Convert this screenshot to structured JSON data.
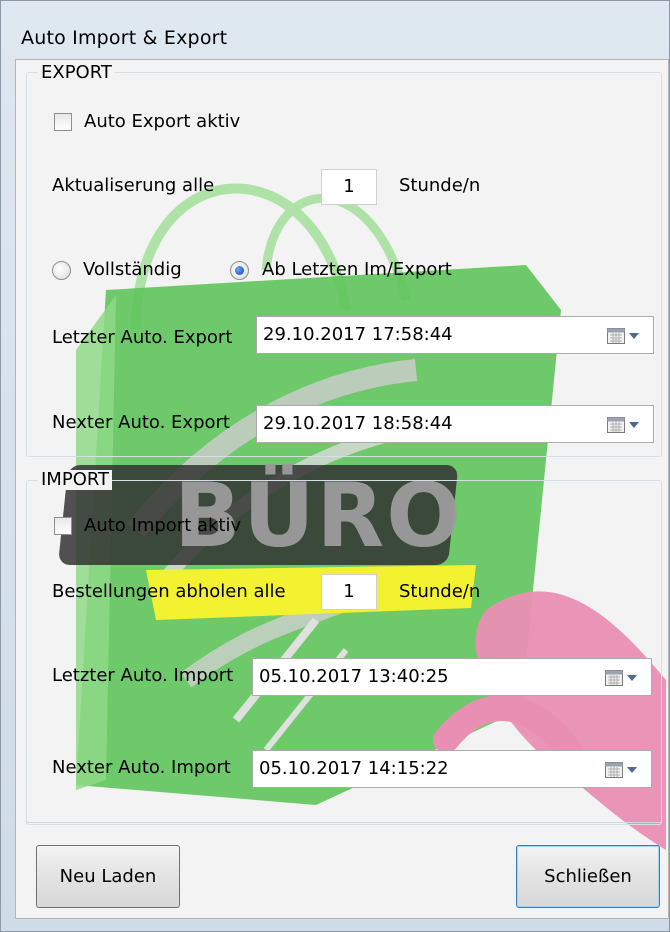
{
  "window": {
    "title": "Auto Import & Export"
  },
  "export": {
    "legend": "EXPORT",
    "auto_checkbox_label": "Auto Export aktiv",
    "interval_label": "Aktualiserung alle",
    "interval_value": "1",
    "interval_unit": "Stunde/n",
    "mode_full_label": "Vollständig",
    "mode_since_last_label": "Ab Letzten Im/Export",
    "last_label": "Letzter Auto. Export",
    "last_value": "29.10.2017 17:58:44",
    "next_label": "Nexter Auto. Export",
    "next_value": "29.10.2017 18:58:44"
  },
  "import": {
    "legend": "IMPORT",
    "auto_checkbox_label": "Auto Import aktiv",
    "interval_label": "Bestellungen abholen alle",
    "interval_value": "1",
    "interval_unit": "Stunde/n",
    "last_label": "Letzter Auto. Import",
    "last_value": "05.10.2017 13:40:25",
    "next_label": "Nexter Auto. Import",
    "next_value": "05.10.2017 14:15:22"
  },
  "buttons": {
    "reload": "Neu Laden",
    "close": "Schließen"
  },
  "watermark": {
    "brand_text": "BÜRO"
  },
  "colors": {
    "watermark_green": "#5fc45c",
    "watermark_yellow": "#f2f230",
    "watermark_pink": "#e98fb3",
    "radio_selected": "#1b5cc4"
  },
  "icons": {
    "checkbox": "checkbox-unchecked",
    "radio_selected": "radio-selected",
    "calendar": "calendar-icon",
    "dropdown": "chevron-down-icon"
  }
}
